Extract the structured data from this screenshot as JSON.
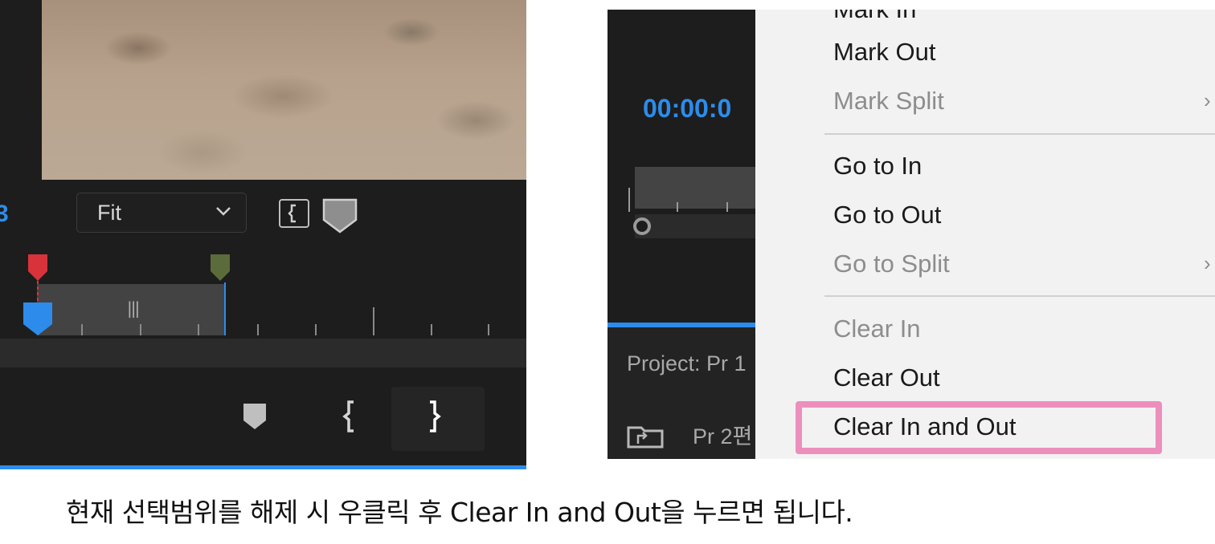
{
  "left_panel": {
    "timecode_fragment": "3",
    "zoom_select": {
      "value": "Fit"
    },
    "range_grip": "|||"
  },
  "right_panel": {
    "timecode": "00:00:0",
    "project_label": "Project: Pr 1",
    "bin_name": "Pr 2편"
  },
  "context_menu": {
    "items": [
      {
        "label": "Mark In",
        "enabled": true
      },
      {
        "label": "Mark Out",
        "enabled": true
      },
      {
        "label": "Mark Split",
        "enabled": false,
        "submenu": true
      },
      {
        "label": "Go to In",
        "enabled": true
      },
      {
        "label": "Go to Out",
        "enabled": true
      },
      {
        "label": "Go to Split",
        "enabled": false,
        "submenu": true
      },
      {
        "label": "Clear In",
        "enabled": false
      },
      {
        "label": "Clear Out",
        "enabled": true
      },
      {
        "label": "Clear In and Out",
        "enabled": true,
        "highlighted": true
      }
    ],
    "submenu_arrow": "›"
  },
  "caption": "현재 선택범위를 해제 시 우클릭 후 Clear In and Out을 누르면 됩니다.",
  "colors": {
    "accent_blue": "#2d8ceb",
    "highlight_pink": "#ec8fbc",
    "in_marker_red": "#d8323b",
    "marker_green": "#5b6b3a",
    "panel_bg": "#1d1d1d",
    "menu_bg": "#f2f2f2"
  },
  "icons": [
    "chevron-down-icon",
    "safe-margins-icon",
    "marker-icon",
    "mark-in-icon",
    "mark-out-icon",
    "folder-icon",
    "playhead-icon"
  ]
}
